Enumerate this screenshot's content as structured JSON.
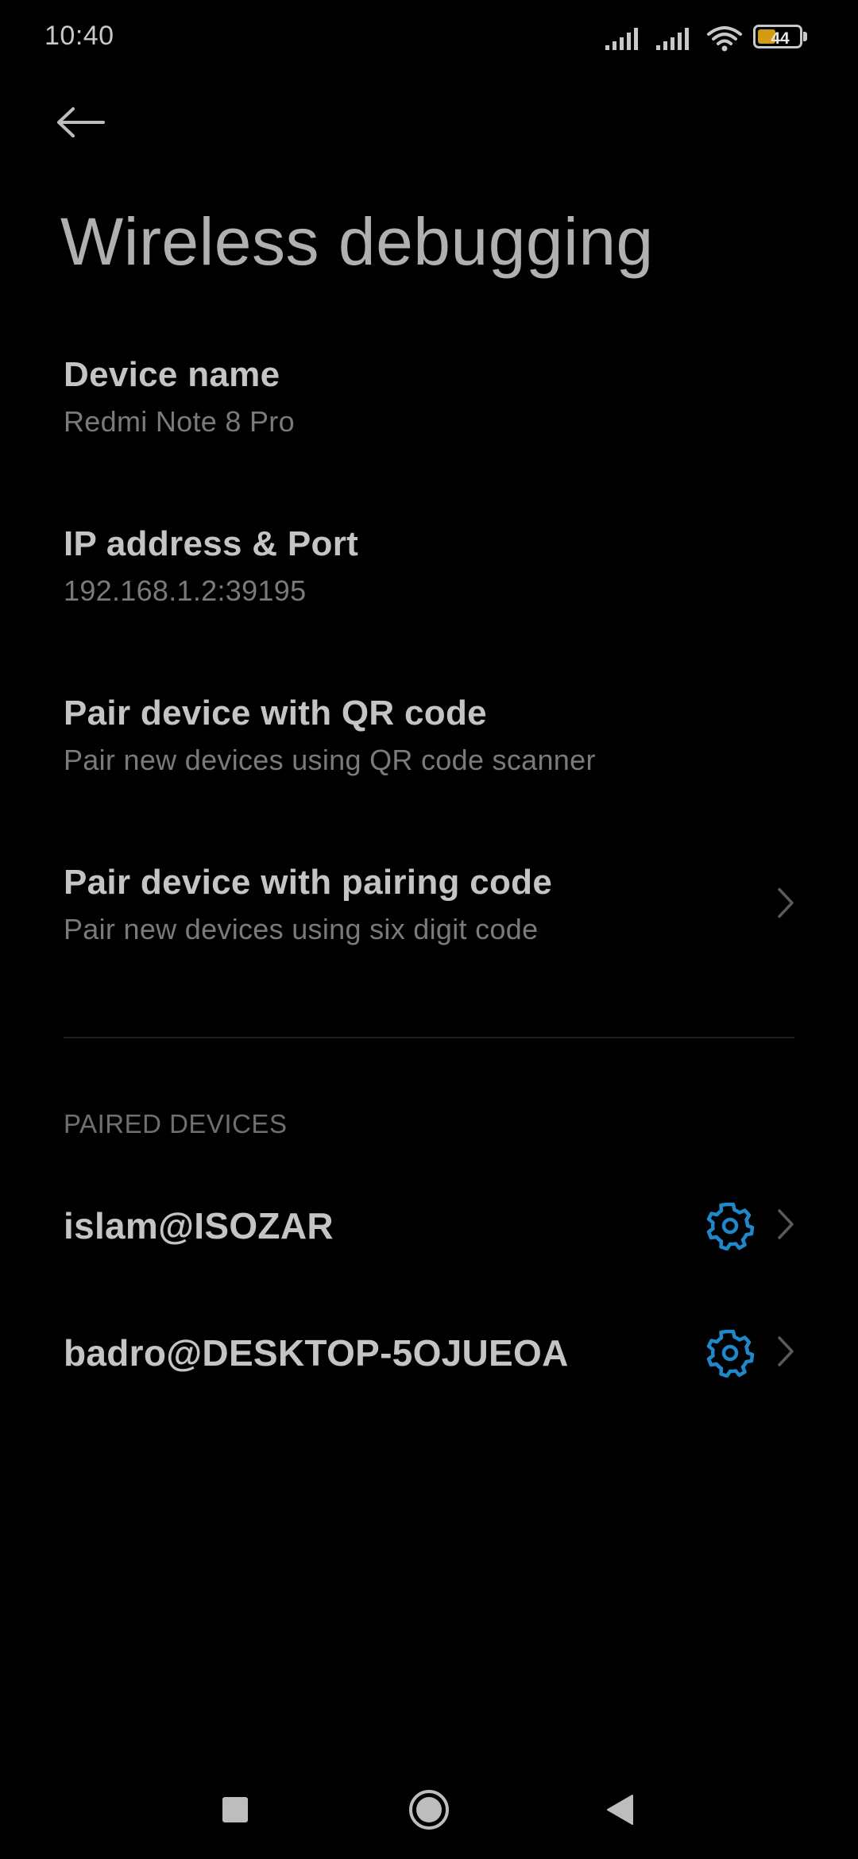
{
  "status_bar": {
    "time": "10:40",
    "battery_level": "44",
    "battery_fraction": 0.44,
    "icons": [
      "signal-icon",
      "signal-icon",
      "wifi-icon",
      "battery-icon"
    ]
  },
  "header": {
    "back_icon": "arrow-left-icon",
    "title": "Wireless debugging"
  },
  "settings": {
    "device_name": {
      "title": "Device name",
      "subtitle": "Redmi Note 8 Pro"
    },
    "ip_port": {
      "title": "IP address & Port",
      "subtitle": "192.168.1.2:39195"
    },
    "pair_qr": {
      "title": "Pair device with QR code",
      "subtitle": "Pair new devices using QR code scanner"
    },
    "pair_code": {
      "title": "Pair device with pairing code",
      "subtitle": "Pair new devices using six digit code"
    }
  },
  "paired_section": {
    "header": "PAIRED DEVICES",
    "devices": [
      {
        "name": "islam@ISOZAR"
      },
      {
        "name": "badro@DESKTOP-5OJUEOA"
      }
    ]
  },
  "nav_bar": {
    "icons": [
      "recents-square-icon",
      "home-circle-icon",
      "back-triangle-icon"
    ]
  },
  "colors": {
    "background": "#000000",
    "accent_gear": "#1e88c8",
    "battery_fill": "#d39a14"
  }
}
